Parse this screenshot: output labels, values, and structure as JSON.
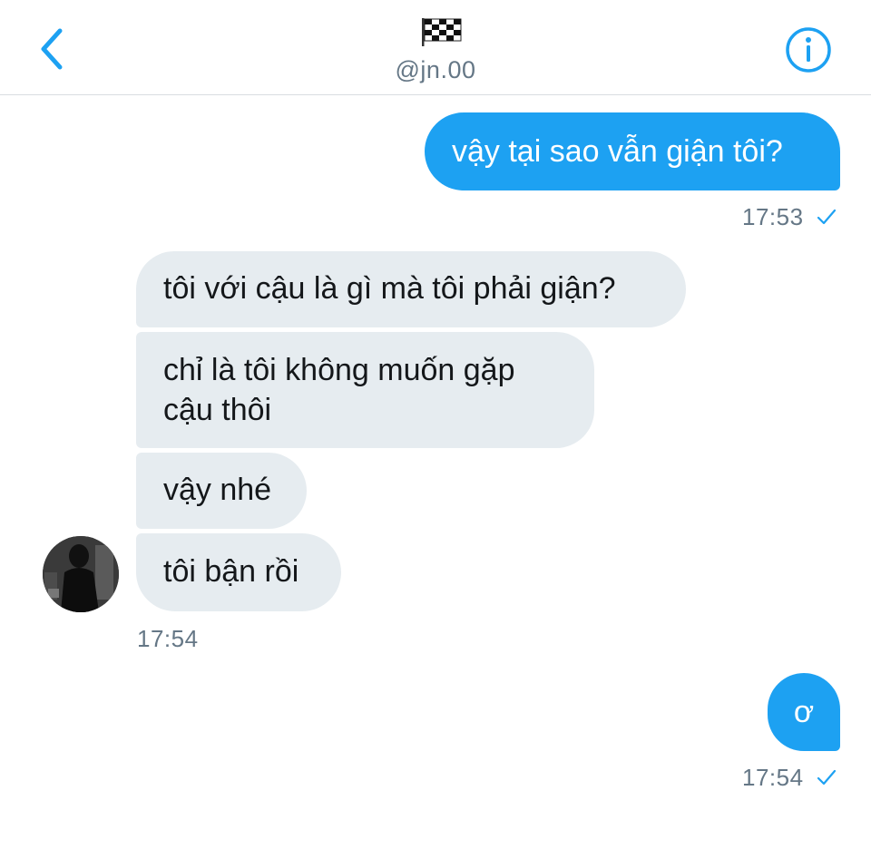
{
  "header": {
    "handle": "@jn.00",
    "back_icon": "chevron-left-icon",
    "flag_icon": "checkered-flag-icon",
    "info_icon": "info-icon"
  },
  "messages": [
    {
      "from": "me",
      "text": "vậy tại sao vẫn giận tôi?"
    },
    {
      "from": "them",
      "text": "tôi với cậu là gì mà tôi phải giận?"
    },
    {
      "from": "them",
      "lines": [
        "chỉ là tôi không muốn gặp",
        "cậu thôi"
      ]
    },
    {
      "from": "them",
      "text": "vậy nhé"
    },
    {
      "from": "them",
      "text": "tôi bận rồi"
    },
    {
      "from": "me",
      "text": "ơ"
    }
  ],
  "timestamps": {
    "t1": "17:53",
    "t2": "17:54",
    "t3": "17:54"
  },
  "colors": {
    "accent": "#1da1f2",
    "received_bubble": "#e6ecf0",
    "meta_text": "#657786"
  }
}
